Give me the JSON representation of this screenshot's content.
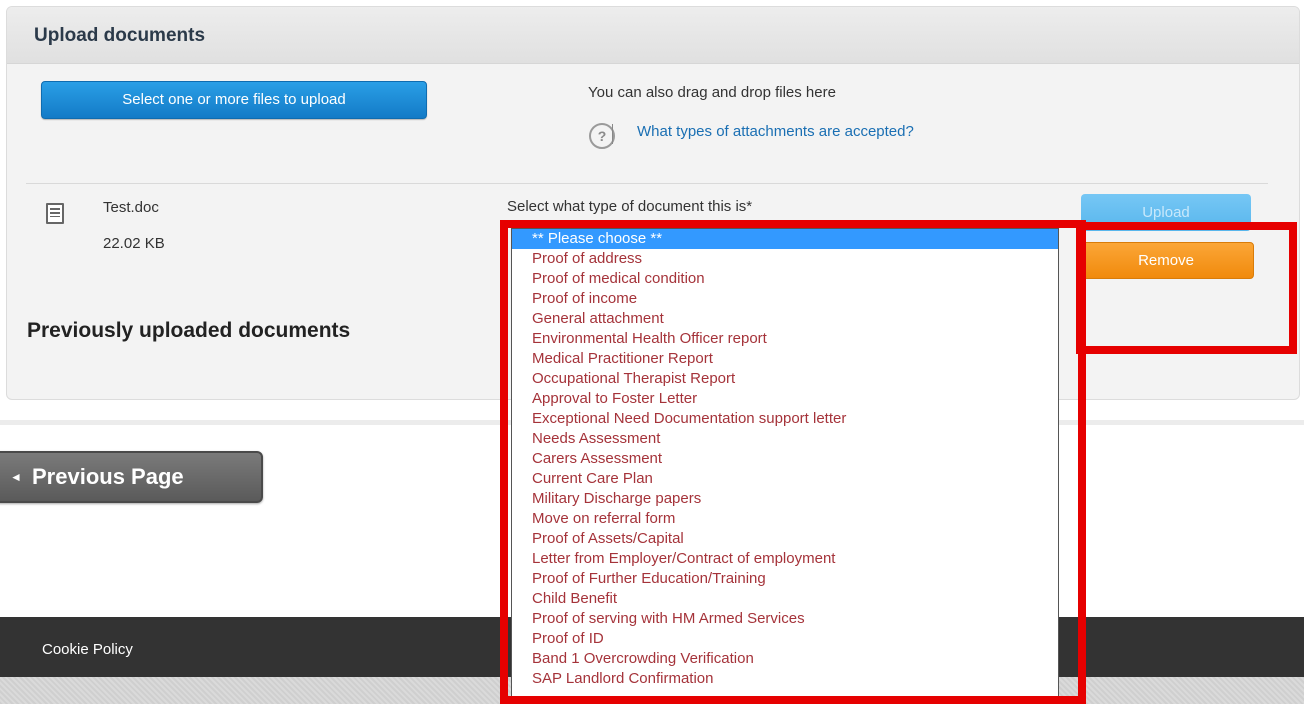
{
  "upload_panel": {
    "title": "Upload documents",
    "select_files_label": "Select one or more files to upload",
    "drag_drop_text": "You can also drag and drop files here",
    "help_glyph": "?",
    "help_link": "What types of attachments are accepted?"
  },
  "file": {
    "name": "Test.doc",
    "size": "22.02 KB",
    "doctype_label": "Select what type of document this is*",
    "upload_label": "Upload",
    "remove_label": "Remove"
  },
  "doctype_options": [
    "** Please choose **",
    "Proof of address",
    "Proof of medical condition",
    "Proof of income",
    "General attachment",
    "Environmental Health Officer report",
    "Medical Practitioner Report",
    "Occupational Therapist Report",
    "Approval to Foster Letter",
    "Exceptional Need Documentation support letter",
    "Needs Assessment",
    "Carers Assessment",
    "Current Care Plan",
    "Military Discharge papers",
    "Move on referral form",
    "Proof of Assets/Capital",
    "Letter from Employer/Contract of employment",
    "Proof of Further Education/Training",
    "Child Benefit",
    "Proof of serving with HM Armed Services",
    "Proof of ID",
    "Band 1 Overcrowding Verification",
    "SAP Landlord Confirmation"
  ],
  "selected_option_index": 0,
  "previously_uploaded_title": "Previously uploaded documents",
  "nav": {
    "previous_page_label": "Previous Page",
    "arrow_glyph": "◄"
  },
  "footer": {
    "cookie_policy": "Cookie Policy"
  },
  "colors": {
    "primary_button": "#1b8ad6",
    "remove_button": "#f4960f",
    "highlight": "#e60000",
    "option_text": "#a5333a",
    "option_selected_bg": "#3399ff"
  }
}
